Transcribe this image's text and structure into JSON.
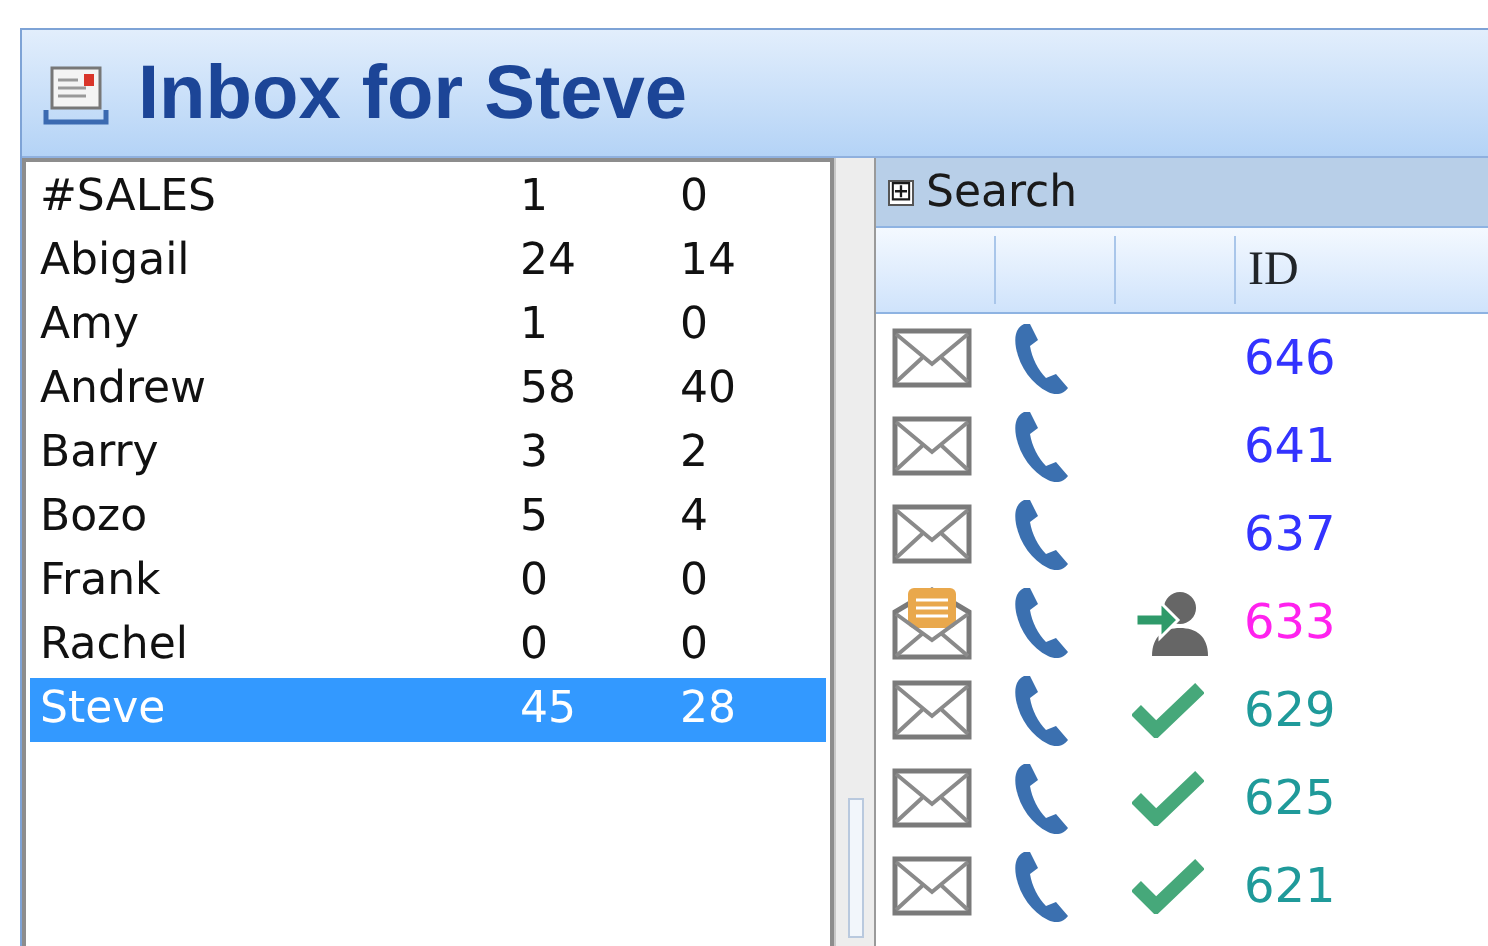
{
  "window": {
    "title": "Inbox for Steve"
  },
  "users": [
    {
      "name": "#SALES",
      "count_1": "1",
      "count_2": "0",
      "selected": false
    },
    {
      "name": "Abigail",
      "count_1": "24",
      "count_2": "14",
      "selected": false
    },
    {
      "name": "Amy",
      "count_1": "1",
      "count_2": "0",
      "selected": false
    },
    {
      "name": "Andrew",
      "count_1": "58",
      "count_2": "40",
      "selected": false
    },
    {
      "name": "Barry",
      "count_1": "3",
      "count_2": "2",
      "selected": false
    },
    {
      "name": "Bozo",
      "count_1": "5",
      "count_2": "4",
      "selected": false
    },
    {
      "name": "Frank",
      "count_1": "0",
      "count_2": "0",
      "selected": false
    },
    {
      "name": "Rachel",
      "count_1": "0",
      "count_2": "0",
      "selected": false
    },
    {
      "name": "Steve",
      "count_1": "45",
      "count_2": "28",
      "selected": true
    }
  ],
  "search": {
    "toggle": "⊞",
    "label": "Search"
  },
  "table": {
    "columns": [
      "ID"
    ],
    "rows": [
      {
        "opened": false,
        "assigned": false,
        "done": false,
        "id": "646",
        "color": "#3333ff"
      },
      {
        "opened": false,
        "assigned": false,
        "done": false,
        "id": "641",
        "color": "#3333ff"
      },
      {
        "opened": false,
        "assigned": false,
        "done": false,
        "id": "637",
        "color": "#3333ff"
      },
      {
        "opened": true,
        "assigned": true,
        "done": false,
        "id": "633",
        "color": "#ff22ee"
      },
      {
        "opened": false,
        "assigned": false,
        "done": true,
        "id": "629",
        "color": "#1f9a9a"
      },
      {
        "opened": false,
        "assigned": false,
        "done": true,
        "id": "625",
        "color": "#1f9a9a"
      },
      {
        "opened": false,
        "assigned": false,
        "done": true,
        "id": "621",
        "color": "#1f9a9a"
      }
    ]
  }
}
